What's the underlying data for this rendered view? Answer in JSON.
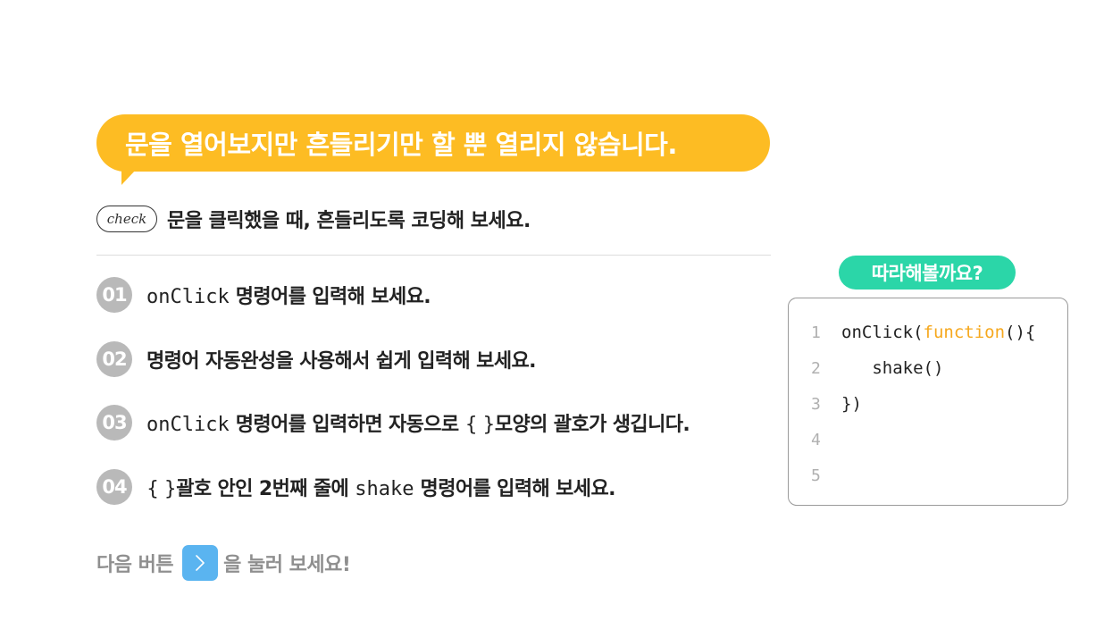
{
  "title_bubble": {
    "text": "문을 열어보지만 흔들리기만 할 뿐 열리지 않습니다."
  },
  "check": {
    "badge": "check",
    "instruction": "문을 클릭했을 때, 흔들리도록 코딩해 보세요."
  },
  "steps": [
    {
      "num": "01",
      "code": "onClick",
      "text": " 명령어를 입력해 보세요."
    },
    {
      "num": "02",
      "text": "명령어 자동완성을 사용해서 쉽게 입력해 보세요."
    },
    {
      "num": "03",
      "code": "onClick",
      "text": " 명령어를 입력하면 자동으로 ",
      "brace": "{ }",
      "text2": "모양의 괄호가 생깁니다."
    },
    {
      "num": "04",
      "brace": "{ }",
      "text": "괄호 안인 2번째 줄에 ",
      "code": "shake",
      "text2": " 명령어를 입력해 보세요."
    }
  ],
  "footer": {
    "before": "다음 버튼",
    "after": "을 눌러 보세요!",
    "next_icon": "chevron-right-icon"
  },
  "follow_along": {
    "label": "따라해볼까요?"
  },
  "code_editor": {
    "lines": [
      {
        "num": "1",
        "pre": "onClick(",
        "kw": "function",
        "post": "(){"
      },
      {
        "num": "2",
        "pre": "   shake()",
        "kw": "",
        "post": ""
      },
      {
        "num": "3",
        "pre": "})",
        "kw": "",
        "post": ""
      },
      {
        "num": "4",
        "pre": "",
        "kw": "",
        "post": ""
      },
      {
        "num": "5",
        "pre": "",
        "kw": "",
        "post": ""
      }
    ]
  },
  "colors": {
    "bubble": "#FDBC23",
    "step_badge": "#B9B9B9",
    "next_button": "#5AB4F0",
    "follow_pill": "#2BD6A8",
    "keyword": "#F6A81E"
  }
}
